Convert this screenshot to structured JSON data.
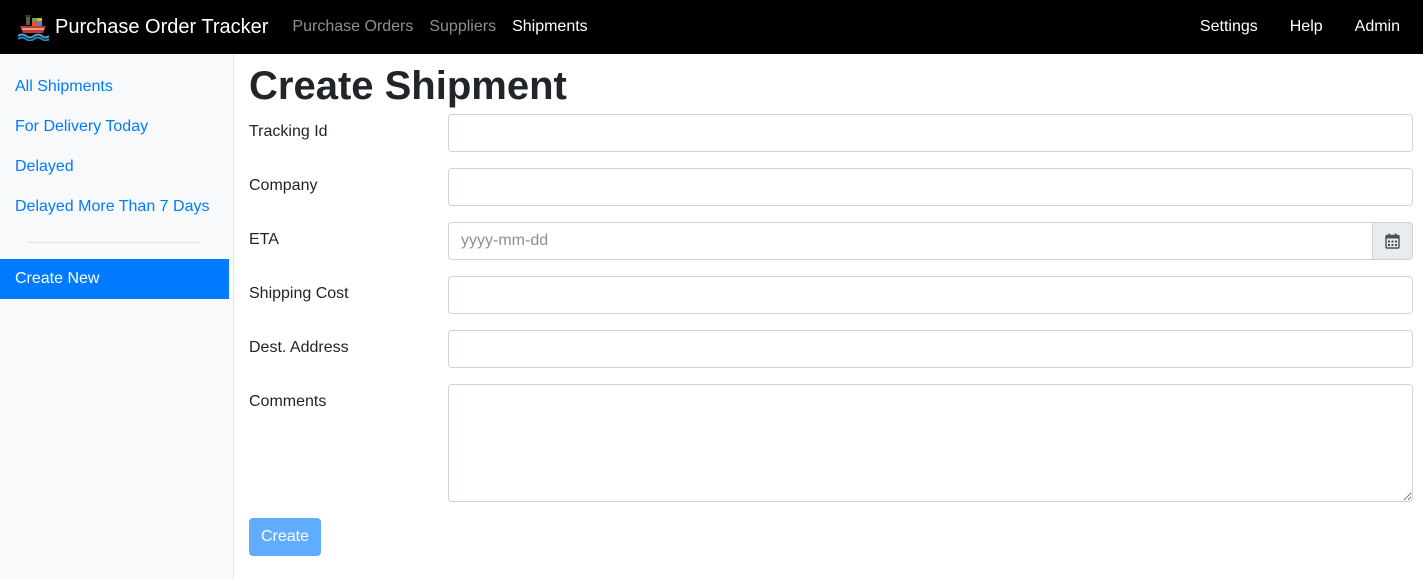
{
  "navbar": {
    "brand": "Purchase Order Tracker",
    "links": [
      "Purchase Orders",
      "Suppliers",
      "Shipments"
    ],
    "active_link": "Shipments",
    "right_links": [
      "Settings",
      "Help",
      "Admin"
    ]
  },
  "sidebar": {
    "items": [
      "All Shipments",
      "For Delivery Today",
      "Delayed",
      "Delayed More Than 7 Days"
    ],
    "create_new": "Create New"
  },
  "page": {
    "title": "Create Shipment"
  },
  "form": {
    "tracking_id": {
      "label": "Tracking Id",
      "value": ""
    },
    "company": {
      "label": "Company",
      "value": ""
    },
    "eta": {
      "label": "ETA",
      "value": "",
      "placeholder": "yyyy-mm-dd"
    },
    "shipping_cost": {
      "label": "Shipping Cost",
      "value": ""
    },
    "dest_address": {
      "label": "Dest. Address",
      "value": ""
    },
    "comments": {
      "label": "Comments",
      "value": ""
    },
    "submit_label": "Create"
  },
  "icons": {
    "brand": "ship-logo-icon",
    "calendar": "calendar-icon"
  },
  "colors": {
    "navbar_bg": "#000000",
    "link_blue": "#007bff",
    "active_bg": "#007bff",
    "button_bg": "#60adff"
  }
}
